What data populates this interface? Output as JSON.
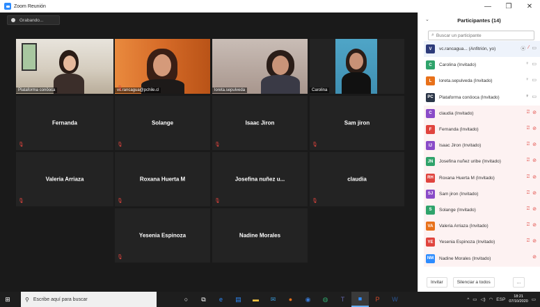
{
  "window": {
    "title": "Zoom Reunión"
  },
  "controls": {
    "minimize": "—",
    "maximize": "❐",
    "close": "✕"
  },
  "recording": {
    "label": "Grabando..."
  },
  "video_tiles": [
    {
      "label": "Plataforma conöoca",
      "active": true
    },
    {
      "label": "vc.rancagua@pchile.cl"
    },
    {
      "label": "loreta.sepulveda"
    },
    {
      "label": "Carolina"
    }
  ],
  "name_tiles": [
    {
      "name": "Fernanda"
    },
    {
      "name": "Solange"
    },
    {
      "name": "Isaac Jiron"
    },
    {
      "name": "Sam jiron"
    },
    {
      "name": "Valeria Arriaza"
    },
    {
      "name": "Roxana Huerta M"
    },
    {
      "name": "Josefina nuñez u..."
    },
    {
      "name": "claudia"
    },
    {
      "name": "Yesenia Espinoza"
    },
    {
      "name": "Nadine Morales"
    }
  ],
  "panel": {
    "title": "Participantes (14)",
    "search_placeholder": "Buscar un participante",
    "participants": [
      {
        "initials": "V",
        "name": "vc.rancagua...  (Anfitrión, yo)",
        "color": "#2d3b7a"
      },
      {
        "initials": "C",
        "name": "Carolina (Invitado)",
        "color": "#2fa36b"
      },
      {
        "initials": "L",
        "name": "loreta.sepulveda (Invitado)",
        "color": "#e8711a"
      },
      {
        "initials": "PC",
        "name": "Plataforma conöoca (Invitado)",
        "color": "#2a3547"
      },
      {
        "initials": "C",
        "name": "claudia (Invitado)",
        "color": "#8a4bc8"
      },
      {
        "initials": "F",
        "name": "Fernanda (Invitado)",
        "color": "#e0443e"
      },
      {
        "initials": "IJ",
        "name": "Isaac Jiron (Invitado)",
        "color": "#8a4bc8"
      },
      {
        "initials": "JN",
        "name": "Josefina nuñez uribe (Invitado)",
        "color": "#2fa36b"
      },
      {
        "initials": "RH",
        "name": "Roxana Huerta M (Invitado)",
        "color": "#e0443e"
      },
      {
        "initials": "SJ",
        "name": "Sam jiron (Invitado)",
        "color": "#8a4bc8"
      },
      {
        "initials": "S",
        "name": "Solange (Invitado)",
        "color": "#2fa36b"
      },
      {
        "initials": "VA",
        "name": "Valeria Arriaza (Invitado)",
        "color": "#e8711a"
      },
      {
        "initials": "YE",
        "name": "Yesenia Espinoza (Invitado)",
        "color": "#e0443e"
      },
      {
        "initials": "NM",
        "name": "Nadine Morales (Invitado)",
        "color": "#2d8cff"
      }
    ],
    "invite_label": "Invitar",
    "mute_all_label": "Silenciar a todos",
    "more_label": "..."
  },
  "taskbar": {
    "search_placeholder": "Escribe aquí para buscar",
    "lang": "ESP",
    "time": "18:21",
    "date": "07/10/2020"
  }
}
